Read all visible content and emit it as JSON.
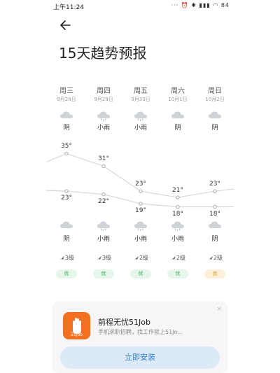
{
  "status_bar": {
    "time": "上午11:24",
    "icons": "··· ⏰ ✱ ▮▮▮ ◠ 84"
  },
  "header": {
    "title": "15天趋势预报"
  },
  "days": [
    {
      "weekday": "周三",
      "date": "9月28日",
      "day_cond": "阴",
      "high": "35°",
      "low": "23°",
      "night_cond": "阴",
      "wind": "3级",
      "aqi": "优"
    },
    {
      "weekday": "周四",
      "date": "9月29日",
      "day_cond": "小雨",
      "high": "31°",
      "low": "22°",
      "night_cond": "小雨",
      "wind": "3级",
      "aqi": "优"
    },
    {
      "weekday": "周五",
      "date": "9月30日",
      "day_cond": "小雨",
      "high": "23°",
      "low": "19°",
      "night_cond": "小雨",
      "wind": "2级",
      "aqi": "优"
    },
    {
      "weekday": "周六",
      "date": "10月1日",
      "day_cond": "阴",
      "high": "21°",
      "low": "18°",
      "night_cond": "小雨",
      "wind": "2级",
      "aqi": "优"
    },
    {
      "weekday": "周日",
      "date": "10月2日",
      "day_cond": "阴",
      "high": "23°",
      "low": "18°",
      "night_cond": "阴",
      "wind": "2级",
      "aqi": "良"
    }
  ],
  "chart_data": {
    "type": "line",
    "categories": [
      "周三",
      "周四",
      "周五",
      "周六",
      "周日"
    ],
    "series": [
      {
        "values": [
          35,
          31,
          23,
          21,
          23
        ]
      },
      {
        "values": [
          23,
          22,
          19,
          18,
          18
        ]
      }
    ]
  },
  "ad": {
    "app_name": "前程无忧51Job",
    "description": "手机求职招聘，找工作就上51Jo...",
    "logo_text": "51Job",
    "install_label": "立即安装",
    "close_icon": "×"
  },
  "colors": {
    "aqi_good": "#2ea84f",
    "aqi_fair": "#d99a2b",
    "install_text": "#2b7cd3",
    "logo_bg": "#f37021"
  }
}
